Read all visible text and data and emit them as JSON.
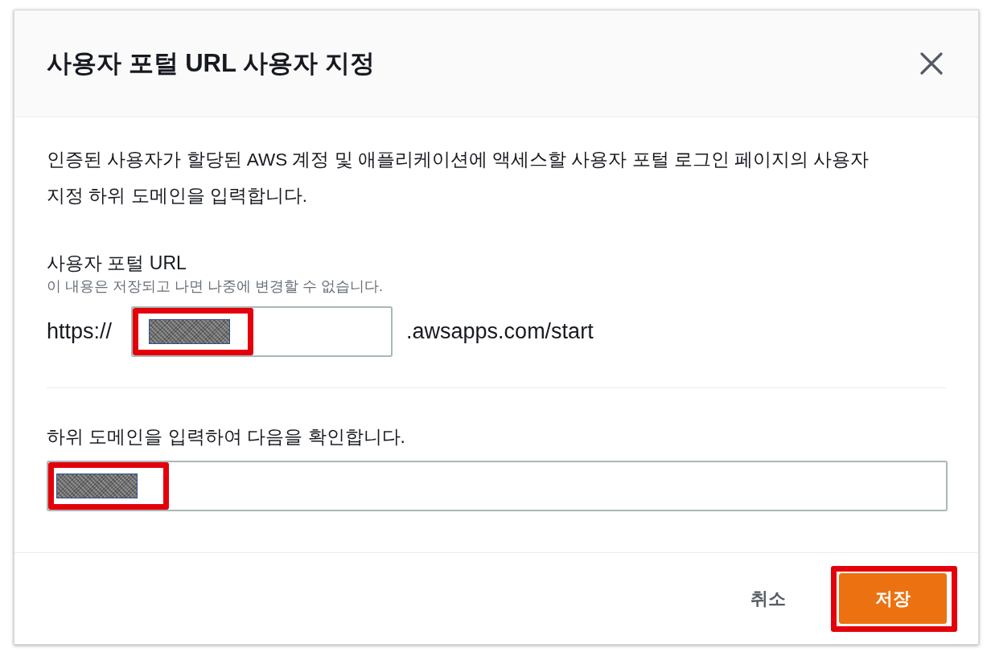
{
  "dialog": {
    "title": "사용자 포털 URL 사용자 지정",
    "description": "인증된 사용자가 할당된 AWS 계정 및 애플리케이션에 액세스할 사용자 포털 로그인 페이지의 사용자 지정 하위 도메인을 입력합니다.",
    "portal_url": {
      "label": "사용자 포털 URL",
      "hint": "이 내용은 저장되고 나면 나중에 변경할 수 없습니다.",
      "prefix": "https://",
      "suffix": ".awsapps.com/start",
      "value_redacted": true,
      "highlighted": true
    },
    "confirm": {
      "label": "하위 도메인을 입력하여 다음을 확인합니다.",
      "value_redacted": true,
      "highlighted": true
    },
    "buttons": [
      {
        "label": "취소",
        "kind": "link",
        "highlighted": false
      },
      {
        "label": "저장",
        "kind": "primary",
        "highlighted": true
      }
    ]
  }
}
